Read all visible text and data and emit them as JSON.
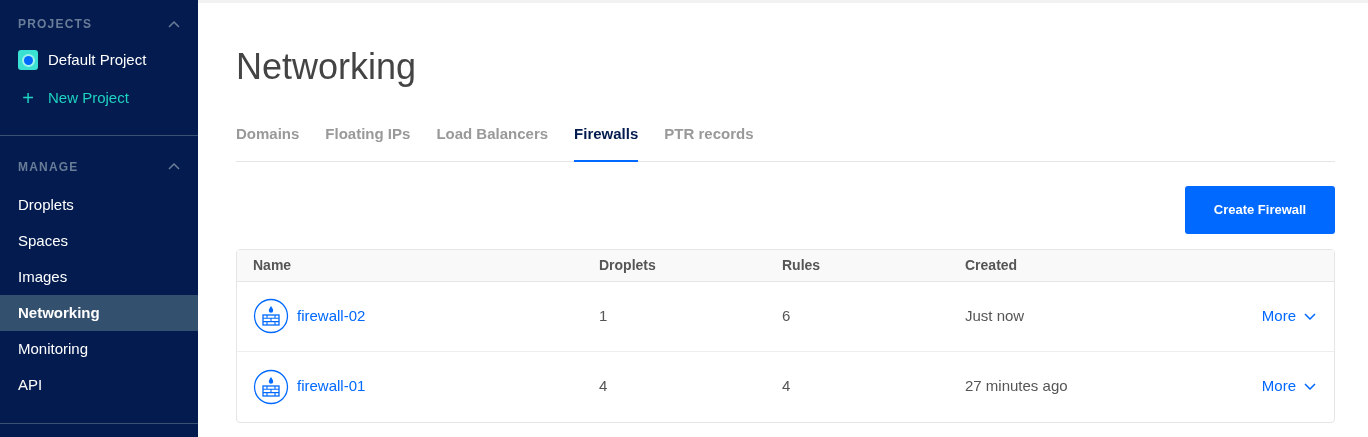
{
  "sidebar": {
    "sections": [
      {
        "heading": "PROJECTS",
        "expanded": true,
        "items": [
          {
            "kind": "project",
            "label": "Default Project",
            "selected": false
          },
          {
            "kind": "add",
            "icon": "+",
            "label": "New Project",
            "selected": false
          }
        ]
      },
      {
        "heading": "MANAGE",
        "expanded": true,
        "items": [
          {
            "kind": "link",
            "label": "Droplets",
            "selected": false
          },
          {
            "kind": "link",
            "label": "Spaces",
            "selected": false
          },
          {
            "kind": "link",
            "label": "Images",
            "selected": false
          },
          {
            "kind": "link",
            "label": "Networking",
            "selected": true
          },
          {
            "kind": "link",
            "label": "Monitoring",
            "selected": false
          },
          {
            "kind": "link",
            "label": "API",
            "selected": false
          }
        ]
      }
    ]
  },
  "page": {
    "title": "Networking",
    "tabs": [
      {
        "label": "Domains",
        "selected": false
      },
      {
        "label": "Floating IPs",
        "selected": false
      },
      {
        "label": "Load Balancers",
        "selected": false
      },
      {
        "label": "Firewalls",
        "selected": true
      },
      {
        "label": "PTR records",
        "selected": false
      }
    ],
    "create_button": "Create Firewall",
    "table": {
      "columns": [
        "Name",
        "Droplets",
        "Rules",
        "Created"
      ],
      "rows": [
        {
          "name": "firewall-02",
          "droplets": "1",
          "rules": "6",
          "created": "Just now",
          "action": "More"
        },
        {
          "name": "firewall-01",
          "droplets": "4",
          "rules": "4",
          "created": "27 minutes ago",
          "action": "More"
        }
      ]
    }
  }
}
